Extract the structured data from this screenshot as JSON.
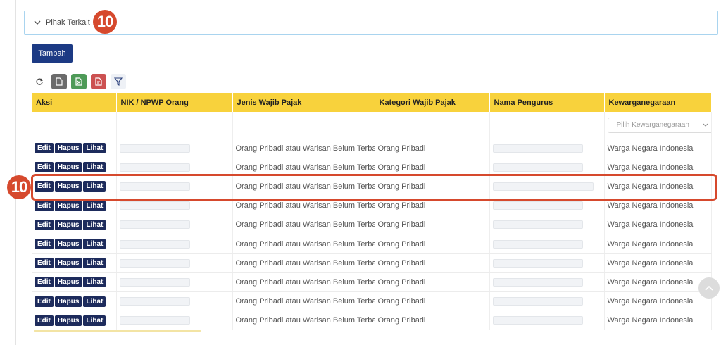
{
  "accordion": {
    "title": "Pihak Terkait",
    "icon": "chevron-down-icon"
  },
  "annotations": {
    "badge_label": "10"
  },
  "actions": {
    "add_label": "Tambah"
  },
  "toolbar": {
    "icons": [
      "refresh-icon",
      "file-icon",
      "excel-export-icon",
      "pdf-export-icon",
      "filter-icon"
    ]
  },
  "table": {
    "headers": [
      "Aksi",
      "NIK / NPWP Orang",
      "Jenis Wajib Pajak",
      "Kategori Wajib Pajak",
      "Nama Pengurus",
      "Kewarganegaraan"
    ],
    "filter": {
      "kewarganegaraan_placeholder": "Pilih Kewarganegaraan"
    },
    "row_actions": {
      "edit": "Edit",
      "hapus": "Hapus",
      "lihat": "Lihat"
    },
    "rows": [
      {
        "jenis": "Orang Pribadi atau Warisan Belum Terbagi",
        "kategori": "Orang Pribadi",
        "kewarganegaraan": "Warga Negara Indonesia"
      },
      {
        "jenis": "Orang Pribadi atau Warisan Belum Terbagi",
        "kategori": "Orang Pribadi",
        "kewarganegaraan": "Warga Negara Indonesia"
      },
      {
        "jenis": "Orang Pribadi atau Warisan Belum Terbagi",
        "kategori": "Orang Pribadi",
        "kewarganegaraan": "Warga Negara Indonesia"
      },
      {
        "jenis": "Orang Pribadi atau Warisan Belum Terbagi",
        "kategori": "Orang Pribadi",
        "kewarganegaraan": "Warga Negara Indonesia"
      },
      {
        "jenis": "Orang Pribadi atau Warisan Belum Terbagi",
        "kategori": "Orang Pribadi",
        "kewarganegaraan": "Warga Negara Indonesia"
      },
      {
        "jenis": "Orang Pribadi atau Warisan Belum Terbagi",
        "kategori": "Orang Pribadi",
        "kewarganegaraan": "Warga Negara Indonesia"
      },
      {
        "jenis": "Orang Pribadi atau Warisan Belum Terbagi",
        "kategori": "Orang Pribadi",
        "kewarganegaraan": "Warga Negara Indonesia"
      },
      {
        "jenis": "Orang Pribadi atau Warisan Belum Terbagi",
        "kategori": "Orang Pribadi",
        "kewarganegaraan": "Warga Negara Indonesia"
      },
      {
        "jenis": "Orang Pribadi atau Warisan Belum Terbagi",
        "kategori": "Orang Pribadi",
        "kewarganegaraan": "Warga Negara Indonesia"
      },
      {
        "jenis": "Orang Pribadi atau Warisan Belum Terbagi",
        "kategori": "Orang Pribadi",
        "kewarganegaraan": "Warga Negara Indonesia"
      }
    ]
  },
  "colors": {
    "header_yellow": "#f8d23c",
    "primary_button": "#1c3a84",
    "action_button": "#1d2b5c",
    "annotation_red": "#d6492d"
  }
}
